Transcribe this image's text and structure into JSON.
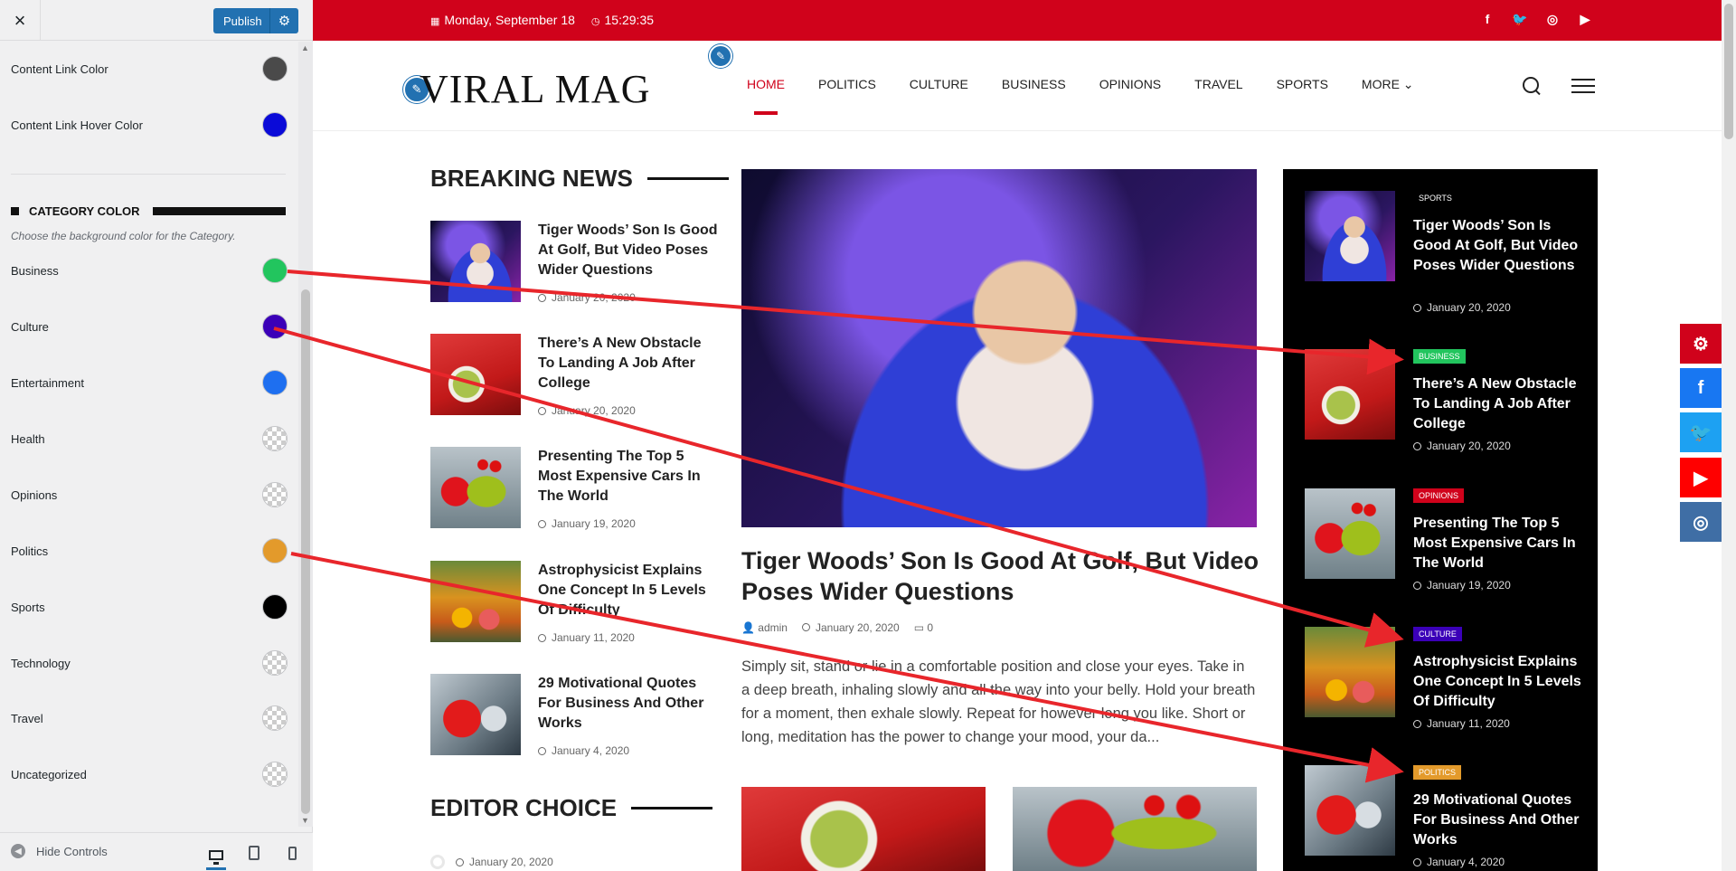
{
  "customizer": {
    "close_icon": "×",
    "publish_label": "Publish",
    "gear_icon": "⚙",
    "rows_top": [
      {
        "label": "Content Link Color",
        "color": "#4a4a4a"
      },
      {
        "label": "Content Link Hover Color",
        "color": "#0a0ad8"
      }
    ],
    "category_heading": "CATEGORY COLOR",
    "category_desc": "Choose the background color for the Category.",
    "categories": [
      {
        "label": "Business",
        "color": "#22c55e"
      },
      {
        "label": "Culture",
        "color": "#3b00b8"
      },
      {
        "label": "Entertainment",
        "color": "#1e6ff0"
      },
      {
        "label": "Health",
        "color": ""
      },
      {
        "label": "Opinions",
        "color": ""
      },
      {
        "label": "Politics",
        "color": "#e39a2b"
      },
      {
        "label": "Sports",
        "color": "#000000"
      },
      {
        "label": "Technology",
        "color": ""
      },
      {
        "label": "Travel",
        "color": ""
      },
      {
        "label": "Uncategorized",
        "color": ""
      }
    ],
    "hide_controls": "Hide Controls"
  },
  "site": {
    "date": "Monday, September 18",
    "time": "15:29:35",
    "social": [
      "f",
      "t",
      "ig",
      "yt"
    ],
    "logo": "VIRAL MAG",
    "nav": [
      "HOME",
      "POLITICS",
      "CULTURE",
      "BUSINESS",
      "OPINIONS",
      "TRAVEL",
      "SPORTS",
      "MORE"
    ],
    "breaking_title": "BREAKING NEWS",
    "breaking": [
      {
        "title": "Tiger Woods’ Son Is Good At Golf, But Video Poses Wider Questions",
        "date": "January 20, 2020"
      },
      {
        "title": "There’s A New Obstacle To Landing A Job After College",
        "date": "January 20, 2020"
      },
      {
        "title": "Presenting The Top 5 Most Expensive Cars In The World",
        "date": "January 19, 2020"
      },
      {
        "title": "Astrophysicist Explains One Concept In 5 Levels Of Difficulty",
        "date": "January 11, 2020"
      },
      {
        "title": "29 Motivational Quotes For Business And Other Works",
        "date": "January 4, 2020"
      }
    ],
    "featured": {
      "title": "Tiger Woods’ Son Is Good At Golf, But Video Poses Wider Questions",
      "author": "admin",
      "date": "January 20, 2020",
      "comments": "0",
      "excerpt": "Simply sit, stand or lie in a comfortable position and close your eyes. Take in a deep breath, inhaling slowly and all the way into your belly. Hold your breath for a moment, then exhale slowly. Repeat for however long you like. Short or long, meditation has the power to change your mood, your da..."
    },
    "editor_title": "EDITOR CHOICE",
    "editor_date": "January 20, 2020",
    "dark_list": [
      {
        "cat": "SPORTS",
        "cat_color": "#000000",
        "title": "Tiger Woods’ Son Is Good At Golf, But Video Poses Wider Questions",
        "date": "January 20, 2020"
      },
      {
        "cat": "BUSINESS",
        "cat_color": "#22c55e",
        "title": "There’s A New Obstacle To Landing A Job After College",
        "date": "January 20, 2020"
      },
      {
        "cat": "OPINIONS",
        "cat_color": "#d0021b",
        "title": "Presenting The Top 5 Most Expensive Cars In The World",
        "date": "January 19, 2020"
      },
      {
        "cat": "CULTURE",
        "cat_color": "#3b00b8",
        "title": "Astrophysicist Explains One Concept In 5 Levels Of Difficulty",
        "date": "January 11, 2020"
      },
      {
        "cat": "POLITICS",
        "cat_color": "#e39a2b",
        "title": "29 Motivational Quotes For Business And Other Works",
        "date": "January 4, 2020"
      }
    ],
    "floating_social": [
      {
        "name": "settings",
        "color": "#d0021b",
        "glyph": "⚙"
      },
      {
        "name": "facebook",
        "color": "#1877f2",
        "glyph": "f"
      },
      {
        "name": "twitter",
        "color": "#1da1f2",
        "glyph": "🐦"
      },
      {
        "name": "youtube",
        "color": "#ff0000",
        "glyph": "▶"
      },
      {
        "name": "instagram",
        "color": "#3f6ea5",
        "glyph": "◎"
      }
    ],
    "accent": "#d0021b"
  }
}
